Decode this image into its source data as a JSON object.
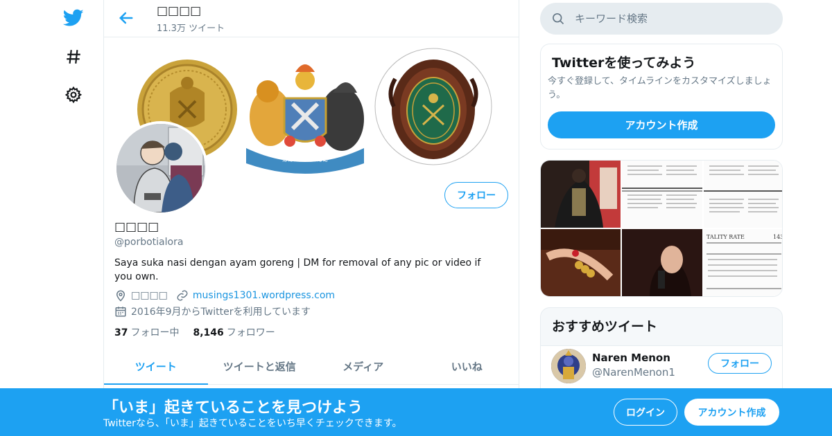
{
  "colors": {
    "accent": "#1da1f2",
    "text": "#14171a",
    "muted": "#657786",
    "border": "#e6ecf0"
  },
  "nav": {
    "icons": [
      "twitter-bird-icon",
      "hashtag-icon",
      "gear-icon"
    ]
  },
  "topbar": {
    "name": "□□□□",
    "tweet_count": "11.3万 ツイート"
  },
  "profile": {
    "name": "□□□□",
    "handle": "@porbotialora",
    "bio": "Saya suka nasi dengan ayam goreng | DM for removal of any pic or video if you own.",
    "location": "□□□□",
    "website": "musings1301.wordpress.com",
    "joined": "2016年9月からTwitterを利用しています",
    "following_count": "37",
    "following_label": "フォロー中",
    "followers_count": "8,146",
    "followers_label": "フォロワー",
    "follow_button": "フォロー"
  },
  "tabs": [
    {
      "label": "ツイート",
      "active": true
    },
    {
      "label": "ツイートと返信",
      "active": false
    },
    {
      "label": "メディア",
      "active": false
    },
    {
      "label": "いいね",
      "active": false
    }
  ],
  "search": {
    "placeholder": "キーワード検索"
  },
  "signup_card": {
    "title": "Twitterを使ってみよう",
    "subtitle": "今すぐ登録して、タイムラインをカスタマイズしましょう。",
    "button": "アカウント作成"
  },
  "recommended": {
    "title": "おすすめツイート",
    "user": {
      "name": "Naren Menon",
      "handle": "@NarenMenon1",
      "follow_button": "フォロー"
    }
  },
  "bottom_bar": {
    "title": "「いま」起きていることを見つけよう",
    "subtitle": "Twitterなら、「いま」起きていることをいち早くチェックできます。",
    "login": "ログイン",
    "signup": "アカウント作成"
  }
}
